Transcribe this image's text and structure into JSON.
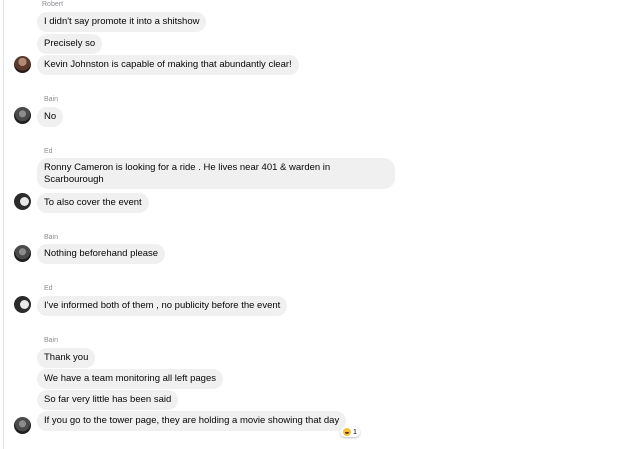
{
  "messages": [
    {
      "sender": "Robert",
      "bubbles": [
        "I didn't say promote it into a shitshow",
        "Precisely so",
        "Kevin Johnston is capable of making that abundantly clear!"
      ]
    },
    {
      "sender": "Bain",
      "bubbles": [
        "No"
      ]
    },
    {
      "sender": "Ed",
      "bubbles": [
        "Ronny Cameron is looking for a ride . He lives near 401 & warden in Scarbourough",
        "To also cover the event"
      ]
    },
    {
      "sender": "Bain",
      "bubbles": [
        "Nothing beforehand please"
      ]
    },
    {
      "sender": "Ed",
      "bubbles": [
        "I've informed both of them , no publicity before the event"
      ]
    },
    {
      "sender": "Bain",
      "bubbles": [
        "Thank you",
        "We have a team monitoring all left pages",
        "So far very little has been said",
        "If you go to the tower page, they are holding a movie showing that day"
      ]
    }
  ],
  "reaction": {
    "emoji": "laughing-face-icon",
    "count": "1"
  }
}
